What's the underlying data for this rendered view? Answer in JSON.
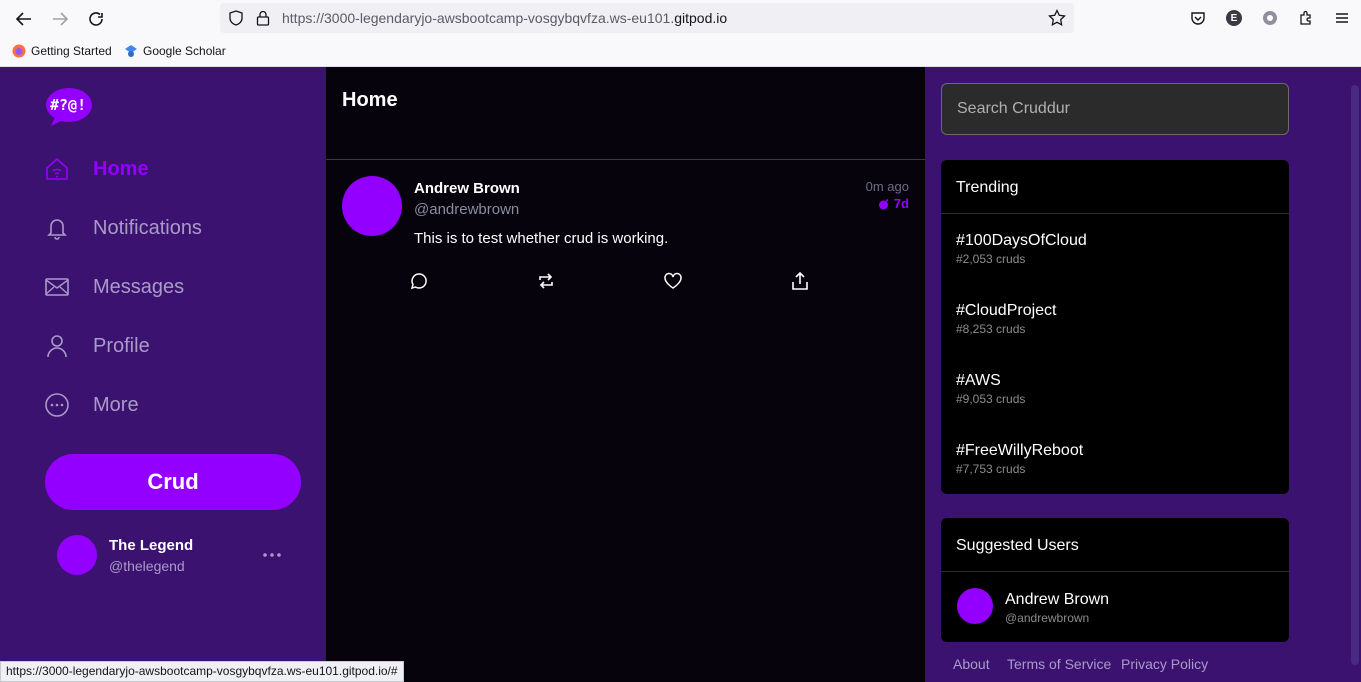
{
  "browser": {
    "url_prefix": "https://3000-legendaryjo-awsbootcamp-vosgybqvfza.ws-eu101.",
    "url_domain": "gitpod.io",
    "profile_initial": "E",
    "bookmarks": [
      {
        "label": "Getting Started",
        "icon": "firefox-icon"
      },
      {
        "label": "Google Scholar",
        "icon": "scholar-icon"
      }
    ],
    "status_link": "https://3000-legendaryjo-awsbootcamp-vosgybqvfza.ws-eu101.gitpod.io/#"
  },
  "app": {
    "logo_text": "#?@!",
    "accent": "#9400ff",
    "nav": [
      {
        "label": "Home",
        "icon": "home-icon",
        "active": true
      },
      {
        "label": "Notifications",
        "icon": "bell-icon",
        "active": false
      },
      {
        "label": "Messages",
        "icon": "envelope-icon",
        "active": false
      },
      {
        "label": "Profile",
        "icon": "person-icon",
        "active": false
      },
      {
        "label": "More",
        "icon": "more-circle-icon",
        "active": false
      }
    ],
    "crud_button": "Crud",
    "me": {
      "name": "The Legend",
      "handle": "@thelegend"
    }
  },
  "feed": {
    "title": "Home",
    "post": {
      "name": "Andrew Brown",
      "handle": "@andrewbrown",
      "time": "0m ago",
      "expires": "7d",
      "text": "This is to test whether crud is working."
    }
  },
  "sidebar_right": {
    "search_placeholder": "Search Cruddur",
    "trending_title": "Trending",
    "trends": [
      {
        "tag": "#100DaysOfCloud",
        "count": "#2,053 cruds"
      },
      {
        "tag": "#CloudProject",
        "count": "#8,253 cruds"
      },
      {
        "tag": "#AWS",
        "count": "#9,053 cruds"
      },
      {
        "tag": "#FreeWillyReboot",
        "count": "#7,753 cruds"
      }
    ],
    "suggested_title": "Suggested Users",
    "suggested": [
      {
        "name": "Andrew Brown",
        "handle": "@andrewbrown"
      }
    ],
    "footer": [
      "About",
      "Terms of Service",
      "Privacy Policy"
    ]
  }
}
